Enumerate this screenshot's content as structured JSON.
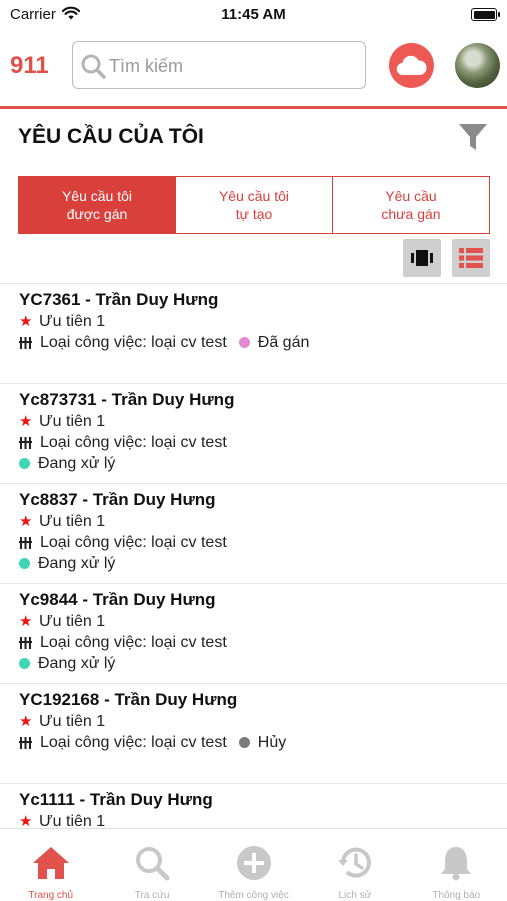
{
  "status_bar": {
    "carrier": "Carrier",
    "time": "11:45 AM",
    "battery_level": 1.0
  },
  "app": {
    "logo": "911"
  },
  "search": {
    "placeholder": "Tìm kiếm",
    "value": ""
  },
  "header_actions": {
    "cloud_icon": "cloud-icon",
    "avatar": "user-avatar"
  },
  "page": {
    "title": "YÊU CẦU CỦA TÔI",
    "filter_icon": "filter-icon"
  },
  "tabs": [
    {
      "label": "Yêu cầu tôi\nđược gán",
      "active": true
    },
    {
      "label": "Yêu cầu tôi\ntự tạo",
      "active": false
    },
    {
      "label": "Yêu cầu\nchưa gán",
      "active": false
    }
  ],
  "view_toggle": {
    "card_icon": "card-view-icon",
    "list_icon": "list-view-icon",
    "selected": "list"
  },
  "requests": [
    {
      "title": "YC7361 - Trần Duy Hưng",
      "priority": "Ưu tiên 1",
      "type": "Loại công việc: loại cv test",
      "status": "Đã gán",
      "status_color": "#e58ad2",
      "status_inline": true
    },
    {
      "title": "Yc873731 - Trần Duy Hưng",
      "priority": "Ưu tiên 1",
      "type": "Loại công việc: loại cv test",
      "status": "Đang xử lý",
      "status_color": "#3ed6b4",
      "status_inline": false
    },
    {
      "title": "Yc8837 - Trần Duy Hưng",
      "priority": "Ưu tiên 1",
      "type": "Loại công việc: loại cv test",
      "status": "Đang xử lý",
      "status_color": "#3ed6b4",
      "status_inline": false
    },
    {
      "title": "Yc9844 - Trần Duy Hưng",
      "priority": "Ưu tiên 1",
      "type": "Loại công việc: loại cv test",
      "status": "Đang xử lý",
      "status_color": "#3ed6b4",
      "status_inline": false
    },
    {
      "title": "YC192168 - Trần Duy Hưng",
      "priority": "Ưu tiên 1",
      "type": "Loại công việc: loại cv test",
      "status": "Hủy",
      "status_color": "#7a7a7a",
      "status_inline": true
    },
    {
      "title": "Yc1111 - Trần Duy Hưng",
      "priority": "Ưu tiên 1",
      "type": "",
      "status": "",
      "status_color": "",
      "status_inline": false
    }
  ],
  "tab_bar": [
    {
      "label": "Trang chủ",
      "icon": "home-icon",
      "active": true
    },
    {
      "label": "Tra cứu",
      "icon": "search-icon",
      "active": false
    },
    {
      "label": "Thêm công việc",
      "icon": "add-circle-icon",
      "active": false
    },
    {
      "label": "Lịch sử",
      "icon": "history-icon",
      "active": false
    },
    {
      "label": "Thông báo",
      "icon": "bell-icon",
      "active": false
    }
  ],
  "colors": {
    "accent": "#e0524b",
    "tab_active": "#d9403b",
    "inactive_icon": "#c8c8c8"
  }
}
